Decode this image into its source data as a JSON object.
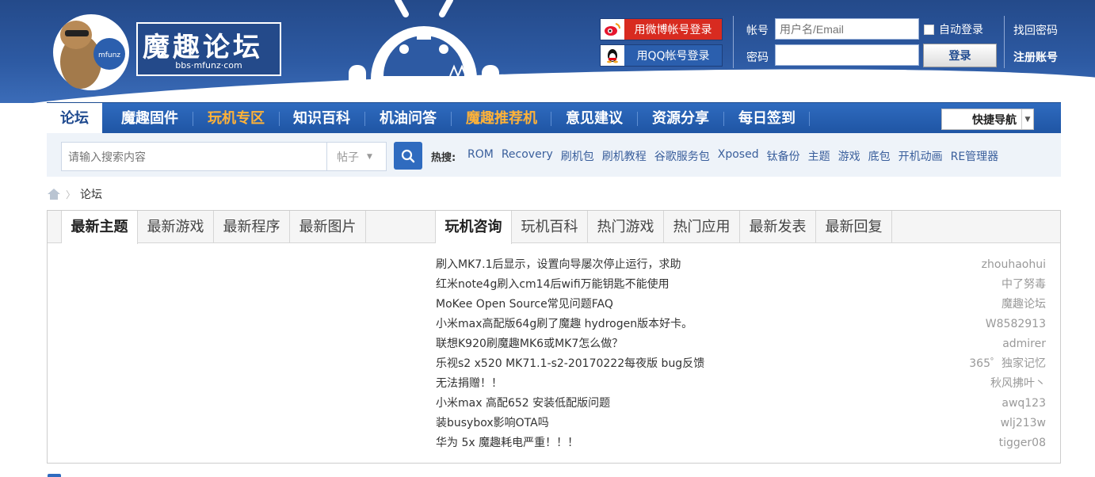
{
  "logo": {
    "title": "魔趣论坛",
    "subtitle": "bbs·mfunz·com"
  },
  "social_login": {
    "weibo_label": "用微博帐号登录",
    "qq_label": "用QQ帐号登录"
  },
  "login": {
    "account_label": "帐号",
    "account_placeholder": "用户名/Email",
    "password_label": "密码",
    "auto_login_label": "自动登录",
    "login_button": "登录",
    "forgot_password": "找回密码",
    "register": "注册账号"
  },
  "nav": {
    "items": [
      {
        "label": "论坛",
        "active": true
      },
      {
        "label": "魔趣固件"
      },
      {
        "label": "玩机专区",
        "highlight": true
      },
      {
        "label": "知识百科"
      },
      {
        "label": "机油问答"
      },
      {
        "label": "魔趣推荐机",
        "highlight": true
      },
      {
        "label": "意见建议"
      },
      {
        "label": "资源分享"
      },
      {
        "label": "每日签到"
      }
    ],
    "quick_nav": "快捷导航"
  },
  "search": {
    "placeholder": "请输入搜索内容",
    "type": "帖子",
    "hot_label": "热搜:",
    "hot_words": [
      "ROM",
      "Recovery",
      "刷机包",
      "刷机教程",
      "谷歌服务包",
      "Xposed",
      "钛备份",
      "主题",
      "游戏",
      "底包",
      "开机动画",
      "RE管理器"
    ]
  },
  "breadcrumb": {
    "current": "论坛"
  },
  "panel": {
    "left_tabs": [
      "最新主题",
      "最新游戏",
      "最新程序",
      "最新图片"
    ],
    "right_tabs": [
      "玩机咨询",
      "玩机百科",
      "热门游戏",
      "热门应用",
      "最新发表",
      "最新回复"
    ],
    "topics": [
      {
        "title": "刷入MK7.1后显示，设置向导屡次停止运行，求助",
        "author": "zhouhaohui"
      },
      {
        "title": "红米note4g刷入cm14后wifi万能钥匙不能使用",
        "author": "中了努毒"
      },
      {
        "title": "MoKee Open Source常见问题FAQ",
        "author": "魔趣论坛"
      },
      {
        "title": "小米max高配版64g刷了魔趣 hydrogen版本好卡。",
        "author": "W8582913"
      },
      {
        "title": "联想K920刷魔趣MK6或MK7怎么做？",
        "author": "admirer"
      },
      {
        "title": "乐视s2 x520 MK71.1-s2-20170222每夜版 bug反馈",
        "author": "365゜独家记忆"
      },
      {
        "title": "无法捐赠！！",
        "author": "秋风拂叶丶"
      },
      {
        "title": "小米max 高配652 安装低配版问题",
        "author": "awq123"
      },
      {
        "title": "装busybox影响OTA吗",
        "author": "wlj213w"
      },
      {
        "title": "华为 5x 魔趣耗电严重！！！",
        "author": "tigger08"
      }
    ]
  },
  "colors": {
    "header_blue": "#244a8a",
    "nav_blue": "#2f6bbf",
    "highlight_orange": "#ffb238",
    "link_blue": "#3a5f9c"
  }
}
